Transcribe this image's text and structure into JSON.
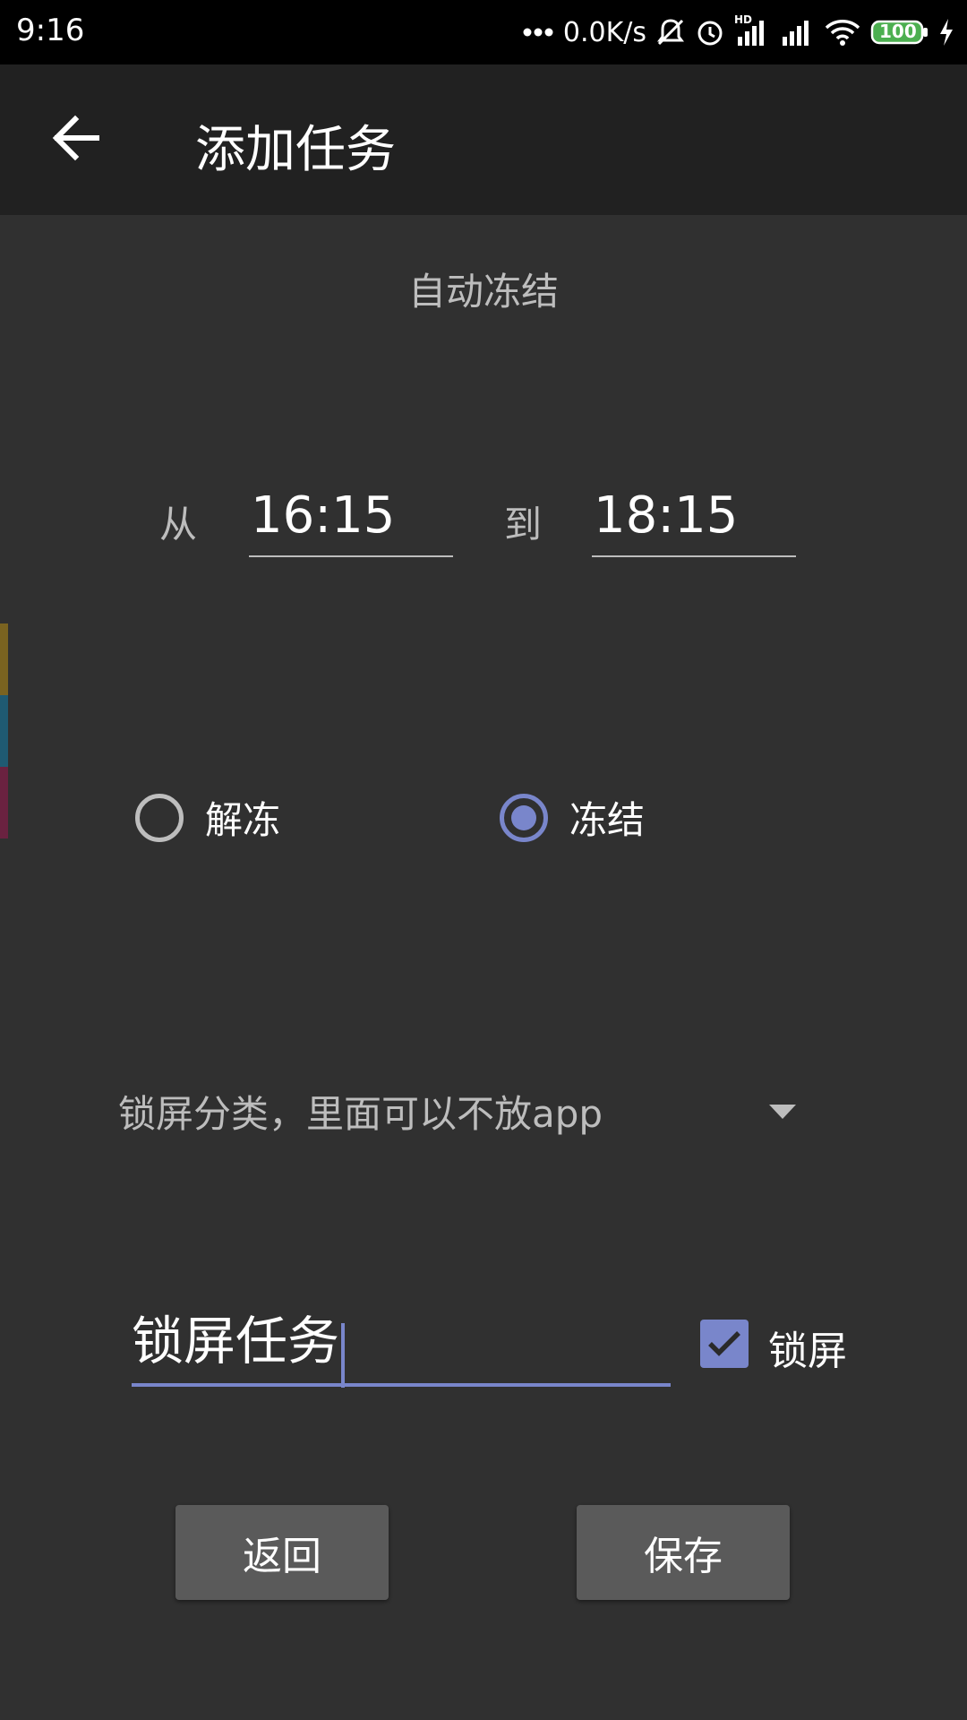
{
  "status_bar": {
    "time": "9:16",
    "network_speed": "0.0K/s",
    "network_type": "HD",
    "battery": "100",
    "icons": [
      "more-dots-icon",
      "mute-icon",
      "alarm-icon",
      "signal-icon",
      "signal-icon",
      "wifi-icon",
      "battery-icon",
      "charging-icon"
    ]
  },
  "app_bar": {
    "back_icon": "arrow-left-icon",
    "title": "添加任务"
  },
  "form": {
    "subtitle": "自动冻结",
    "from_label": "从",
    "from_time": "16:15",
    "to_label": "到",
    "to_time": "18:15",
    "radio_options": [
      {
        "label": "解冻",
        "selected": false
      },
      {
        "label": "冻结",
        "selected": true
      }
    ],
    "category_selected": "锁屏分类，里面可以不放app",
    "task_name": "锁屏任务",
    "lock_screen_label": "锁屏",
    "lock_screen_checked": true
  },
  "buttons": {
    "back": "返回",
    "save": "保存"
  },
  "colors": {
    "accent": "#7986cb",
    "background": "#303030",
    "app_bar": "#212121",
    "side_strip": [
      "#7a6320",
      "#1f5a72",
      "#6a2240"
    ]
  }
}
